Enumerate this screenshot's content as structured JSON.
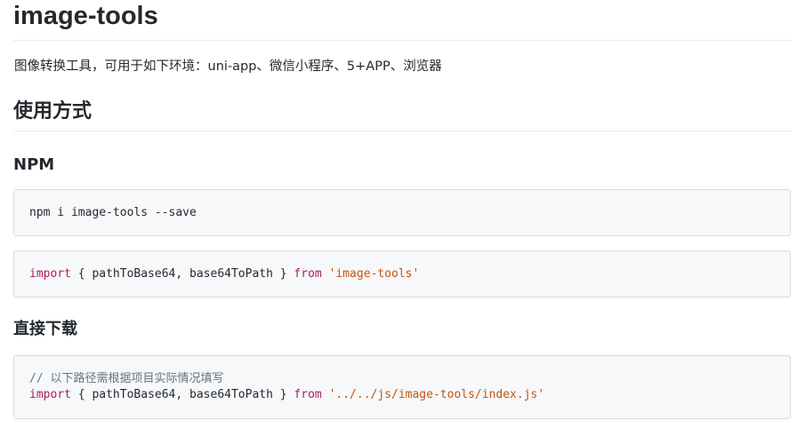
{
  "title": "image-tools",
  "description": "图像转换工具，可用于如下环境：uni-app、微信小程序、5+APP、浏览器",
  "usage_heading": "使用方式",
  "npm_section": {
    "heading": "NPM",
    "install_command": "npm i image-tools --save",
    "import_line": {
      "keyword": "import",
      "names": " { pathToBase64, base64ToPath } ",
      "from": "from",
      "source": "'image-tools'"
    }
  },
  "download_section": {
    "heading": "直接下载",
    "comment": "// 以下路径需根据项目实际情况填写",
    "import_line": {
      "keyword": "import",
      "names": " { pathToBase64, base64ToPath } ",
      "from": "from",
      "source": "'../../js/image-tools/index.js'"
    }
  }
}
